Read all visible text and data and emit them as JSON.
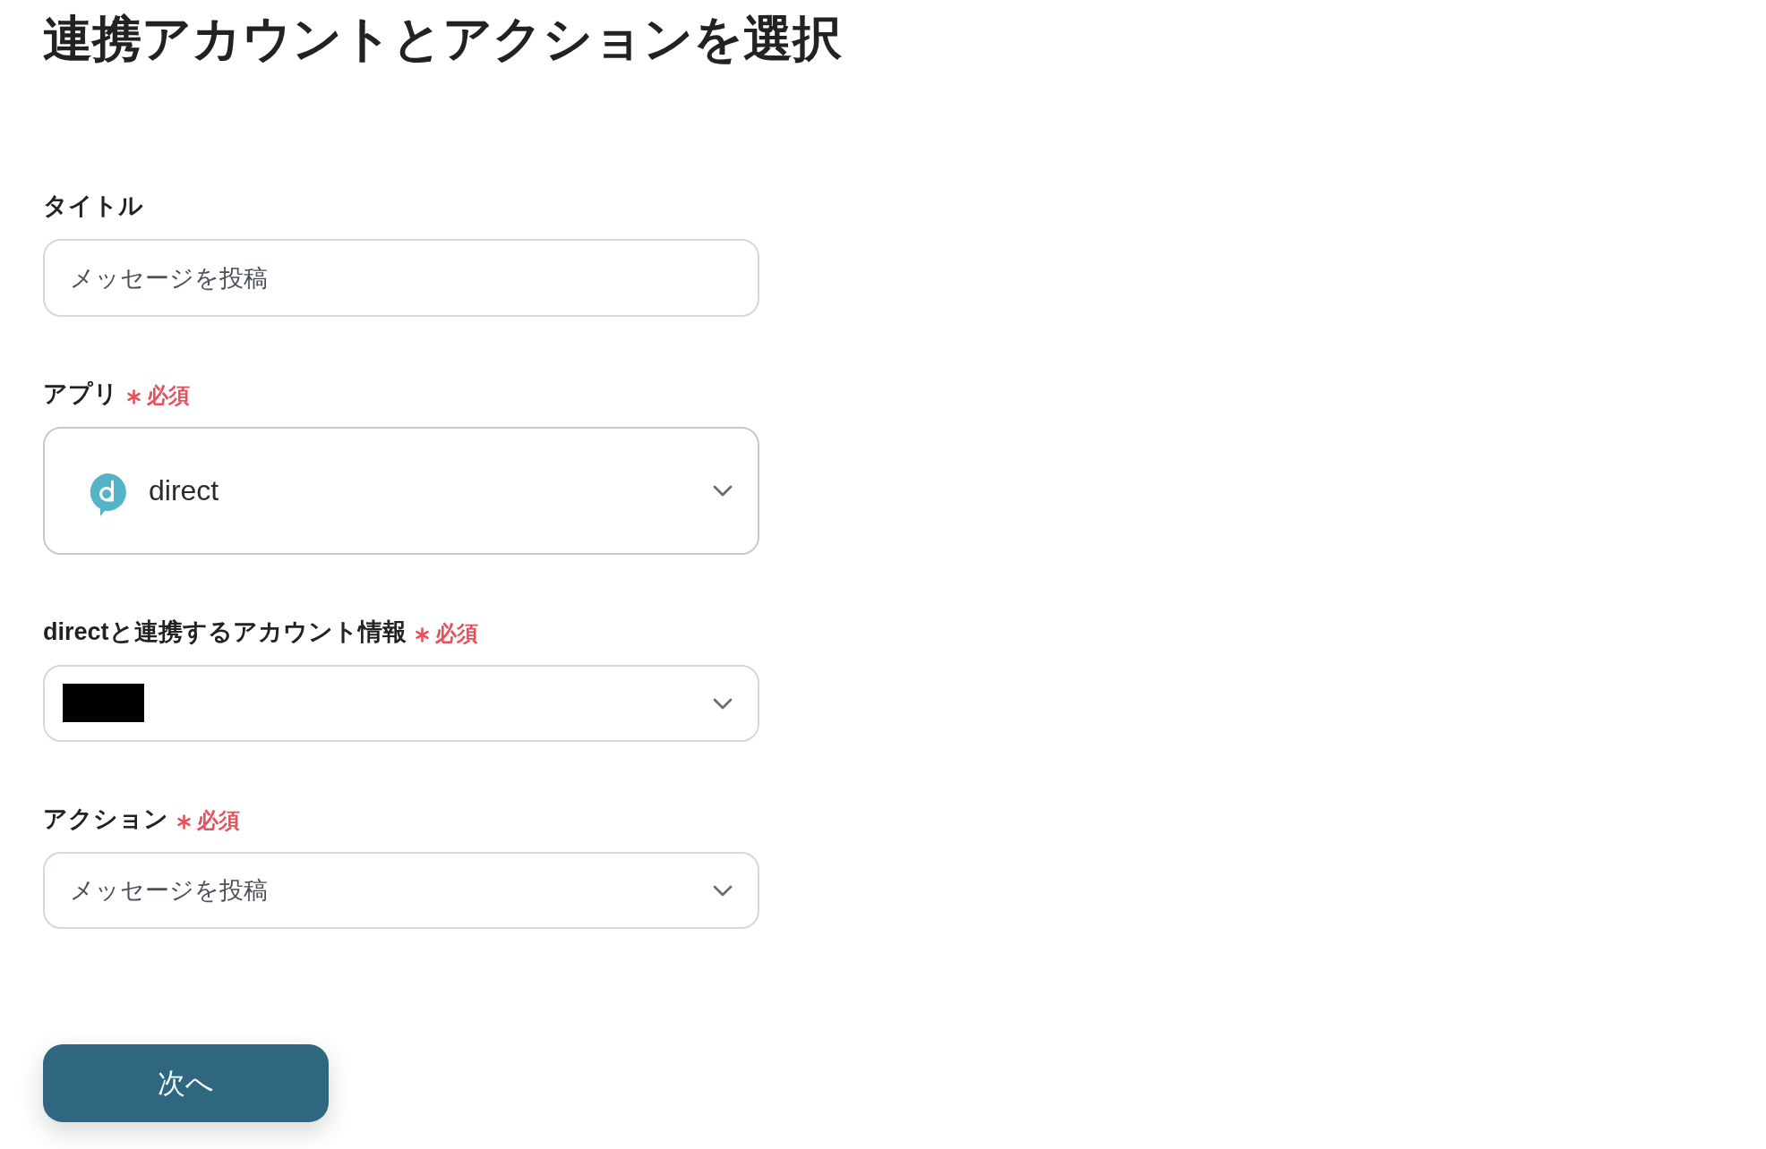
{
  "page_title": "連携アカウントとアクションを選択",
  "fields": [
    {
      "kind": "text_input",
      "label": "タイトル",
      "required": false,
      "value": "メッセージを投稿"
    },
    {
      "kind": "app_select",
      "label": "アプリ",
      "required": true,
      "required_label": "必須",
      "value": "direct",
      "redacted": false
    },
    {
      "kind": "select",
      "label": "directと連携するアカウント情報",
      "required": true,
      "required_label": "必須",
      "redacted": true
    },
    {
      "kind": "select",
      "label": "アクション",
      "required": true,
      "required_label": "必須",
      "value": "メッセージを投稿",
      "redacted": false
    }
  ],
  "next_button": {
    "label": "次へ"
  }
}
